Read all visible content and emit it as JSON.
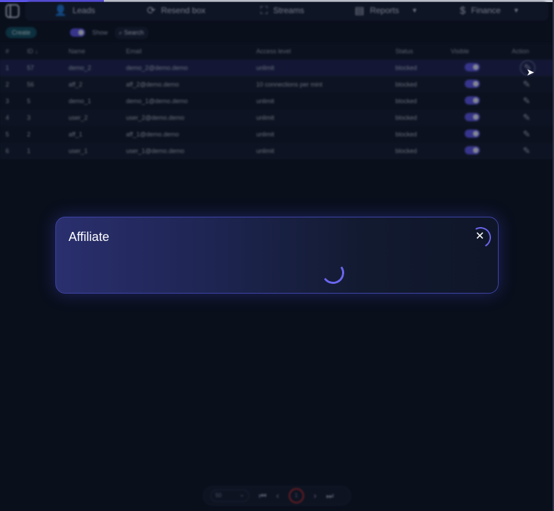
{
  "nav": {
    "items": [
      {
        "label": "Leads",
        "icon": "user-check-icon"
      },
      {
        "label": "Resend box",
        "icon": "refresh-icon"
      },
      {
        "label": "Streams",
        "icon": "expand-icon"
      },
      {
        "label": "Reports",
        "icon": "document-icon"
      },
      {
        "label": "Finance",
        "icon": "dollar-icon"
      }
    ]
  },
  "toolbar": {
    "create_label": "Create",
    "show_label": "Show",
    "search_label": "Search"
  },
  "table": {
    "columns": [
      "#",
      "ID",
      "Name",
      "Email",
      "Access level",
      "Status",
      "Visible",
      "Action"
    ],
    "rows": [
      {
        "n": "1",
        "id": "57",
        "name": "demo_2",
        "email": "demo_2@demo.demo",
        "access": "unlimit",
        "status": "blocked"
      },
      {
        "n": "2",
        "id": "56",
        "name": "aff_2",
        "email": "aff_2@demo.demo",
        "access": "10 connections per mint",
        "status": "blocked"
      },
      {
        "n": "3",
        "id": "5",
        "name": "demo_1",
        "email": "demo_1@demo.demo",
        "access": "unlimit",
        "status": "blocked"
      },
      {
        "n": "4",
        "id": "3",
        "name": "user_2",
        "email": "user_2@demo.demo",
        "access": "unlimit",
        "status": "blocked"
      },
      {
        "n": "5",
        "id": "2",
        "name": "aff_1",
        "email": "aff_1@demo.demo",
        "access": "unlimit",
        "status": "blocked"
      },
      {
        "n": "6",
        "id": "1",
        "name": "user_1",
        "email": "user_1@demo.demo",
        "access": "unlimit",
        "status": "blocked"
      }
    ]
  },
  "pager": {
    "page_size": "50",
    "current_page": "1"
  },
  "modal": {
    "title": "Affiliate"
  },
  "colors": {
    "accent": "#5b53e6",
    "background": "#0a0f1c"
  }
}
